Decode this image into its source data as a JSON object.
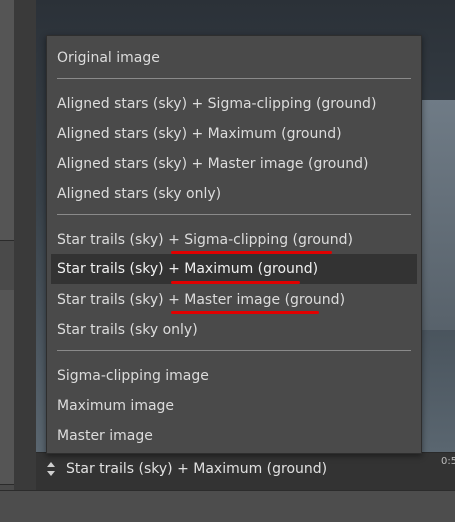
{
  "menu": {
    "items": [
      "Original image",
      "Aligned stars (sky) + Sigma-clipping (ground)",
      "Aligned stars (sky) + Maximum (ground)",
      "Aligned stars (sky) + Master image (ground)",
      "Aligned stars (sky only)",
      "Star trails (sky) + Sigma-clipping (ground)",
      "Star trails (sky) + Maximum (ground)",
      "Star trails (sky) + Master image (ground)",
      "Star trails (sky only)",
      "Sigma-clipping image",
      "Maximum image",
      "Master image"
    ],
    "selected_index": 6,
    "highlight_color": "#e00000"
  },
  "select": {
    "value": "Star trails (sky) + Maximum (ground)",
    "icon": "up-down-arrows-icon"
  },
  "timebar": {
    "label": "0:5"
  }
}
